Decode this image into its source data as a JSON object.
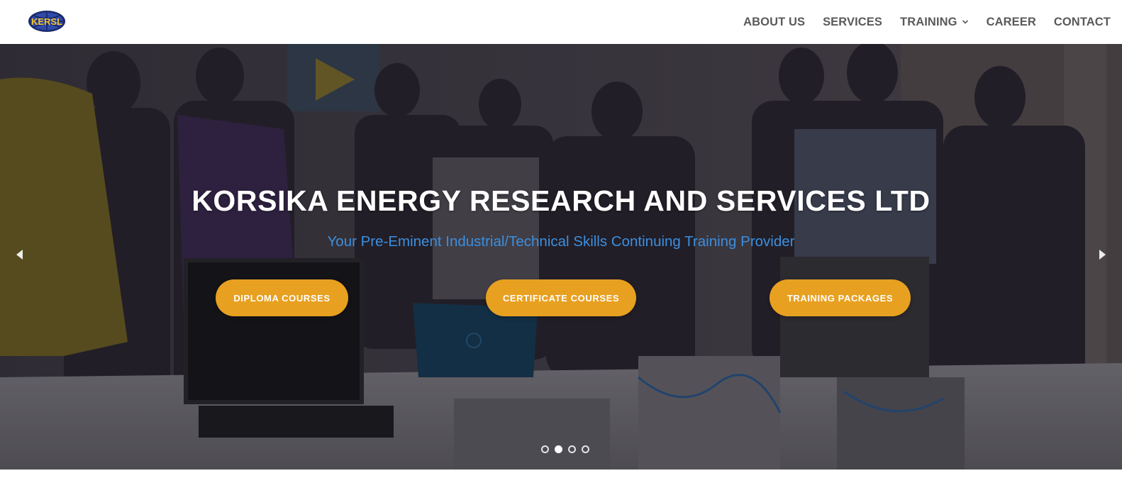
{
  "header": {
    "logo_alt": "KERSL logo",
    "logo_text": "KERSL",
    "nav": [
      {
        "label": "ABOUT US"
      },
      {
        "label": "SERVICES"
      },
      {
        "label": "TRAINING",
        "has_dropdown": true
      },
      {
        "label": "CAREER"
      },
      {
        "label": "CONTACT"
      }
    ]
  },
  "hero": {
    "title": "KORSIKA ENERGY RESEARCH AND SERVICES LTD",
    "subtitle": "Your Pre-Eminent Industrial/Technical Skills Continuing Training Provider",
    "buttons": [
      {
        "label": "DIPLOMA COURSES"
      },
      {
        "label": "CERTIFICATE COURSES"
      },
      {
        "label": "TRAINING PACKAGES"
      }
    ],
    "slider": {
      "total_slides": 4,
      "active_index": 1,
      "prev_icon": "triangle-left-icon",
      "next_icon": "triangle-right-icon"
    }
  },
  "colors": {
    "accent": "#e8a020",
    "subtitle": "#3b8fe0",
    "nav_text": "#5a5a5a"
  }
}
